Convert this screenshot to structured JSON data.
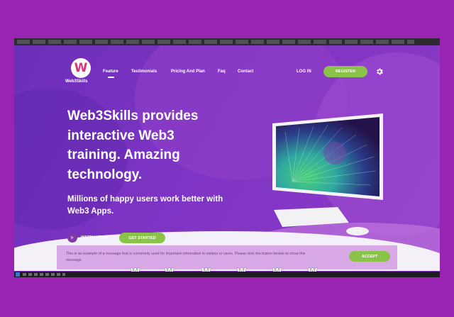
{
  "browser": {
    "tray_text": ""
  },
  "header": {
    "logo_letter": "W",
    "brand": "Web3Skills",
    "nav": [
      "Feature",
      "Testimonials",
      "Pricing And Plan",
      "Faq",
      "Contact"
    ],
    "active_nav": "Feature",
    "login_label": "LOG IN",
    "register_label": "REGISTER"
  },
  "hero": {
    "headline": "Web3Skills provides interactive Web3 training. Amazing technology.",
    "subline": "Millions of happy users work better with Web3 Apps.",
    "watch_label": "WATCH VIDEO",
    "cta_label": "GET STARTED"
  },
  "cookie": {
    "text": "This is an example of a message that is commonly used for important information to visitors or users. Please click the button beside to close this message.",
    "accept_label": "ACCEPT"
  },
  "partners": [
    "W",
    "W",
    "W",
    "W",
    "W",
    "W"
  ],
  "colors": {
    "page_bg": "#9a24b2",
    "hero_bg": "#7e34c4",
    "accent_green": "#8bc34a",
    "logo_pink": "#e0307a",
    "cookie_bg": "#d9a8e6"
  }
}
